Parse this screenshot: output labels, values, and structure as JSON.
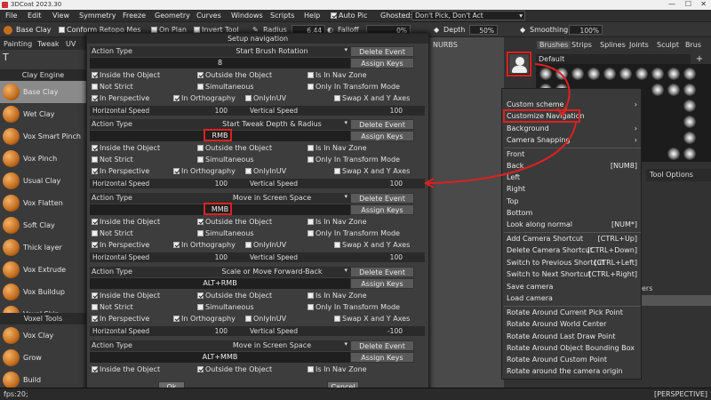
{
  "window": {
    "title": "3DCoat 2023.30"
  },
  "menubar": [
    "File",
    "Edit",
    "View",
    "Symmetry",
    "Freeze",
    "Geometry",
    "Curves",
    "Windows",
    "Scripts",
    "Help"
  ],
  "auto_pic": "Auto Pic",
  "ghosted": {
    "label": "Ghosted:",
    "value": "Don't Pick, Don't Act"
  },
  "toolbar": {
    "base_clay": "Base Clay",
    "conform": "Conform Retopo Mes",
    "on_plan": "On Plan",
    "invert_tool": "Invert Tool",
    "radius_label": "Radius",
    "radius_value": "6.44",
    "falloff_label": "Falloff",
    "falloff_value": "0%",
    "depth_label": "Depth",
    "depth_value": "50%",
    "smoothing_label": "Smoothing",
    "smoothing_value": "100%"
  },
  "left_tabs": [
    "Painting",
    "Tweak",
    "UV"
  ],
  "left_panel": {
    "clay_engine": "Clay Engine",
    "clay_items": [
      "Base Clay",
      "Wet Clay",
      "Vox Smart Pinch",
      "Vox Pinch",
      "Usual Clay",
      "Vox Flatten",
      "Soft Clay",
      "Thick layer",
      "Vox Extrude",
      "Vox Buildup",
      "Voxel Skin"
    ],
    "voxel_tools": "Voxel Tools",
    "voxel_items": [
      "Vox Clay",
      "Grow",
      "Build"
    ]
  },
  "dialog": {
    "title": "Setup navigation",
    "action_type": "Action Type",
    "delete_event": "Delete Event",
    "assign_keys": "Assign Keys",
    "ok": "Ok",
    "cancel": "Cancel",
    "opt": {
      "inside": "Inside the Object",
      "outside": "Outside the Object",
      "nav_zone": "Is In Nav Zone",
      "not_strict": "Not Strict",
      "simultaneous": "Simultaneous",
      "transform_mode": "Only In Transform Mode",
      "perspective": "In Perspective",
      "orthography": "In Orthography",
      "only_uv": "OnlyInUV",
      "swap": "Swap X and Y Axes",
      "hspeed": "Horizontal Speed",
      "vspeed": "Vertical Speed"
    },
    "events": [
      {
        "action": "Start Brush Rotation",
        "keys": "8",
        "hspeed": "100",
        "vspeed": "100",
        "inside": true,
        "outside": true,
        "nav": false,
        "not_strict": false,
        "simult": false,
        "transform": false,
        "persp": true,
        "ortho": true,
        "uv": false,
        "swap": false
      },
      {
        "action": "Start Tweak Depth & Radius",
        "keys": "RMB",
        "hspeed": "100",
        "vspeed": "100",
        "inside": true,
        "outside": false,
        "nav": false,
        "not_strict": false,
        "simult": false,
        "transform": false,
        "persp": true,
        "ortho": true,
        "uv": false,
        "swap": false
      },
      {
        "action": "Move in Screen Space",
        "keys": "MMB",
        "hspeed": "100",
        "vspeed": "100",
        "inside": true,
        "outside": true,
        "nav": false,
        "not_strict": false,
        "simult": false,
        "transform": false,
        "persp": true,
        "ortho": true,
        "uv": false,
        "swap": false
      },
      {
        "action": "Scale or Move Forward-Back",
        "keys": "ALT+RMB",
        "hspeed": "100",
        "vspeed": "-100",
        "inside": true,
        "outside": true,
        "nav": false,
        "not_strict": false,
        "simult": false,
        "transform": false,
        "persp": true,
        "ortho": true,
        "uv": false,
        "swap": false
      },
      {
        "action": "Move in Screen Space",
        "keys": "ALT+MMB",
        "inside": true,
        "outside": true,
        "nav": false
      }
    ]
  },
  "viewport": {
    "nurbs": "NURBS",
    "close": "×"
  },
  "right_panel": {
    "tabs": [
      "Brushes",
      "Strips",
      "Splines",
      "Joints",
      "Sculpt",
      "Brus"
    ],
    "default_label": "Default",
    "tool_options": "Tool Options",
    "side_label": "ers"
  },
  "context_menu": {
    "items": [
      {
        "label": "Custom scheme",
        "sc": "›"
      },
      {
        "label": "Customize Navigation",
        "sc": ""
      },
      {
        "label": "Background",
        "sc": "›"
      },
      {
        "label": "Camera Snapping",
        "sc": "›"
      },
      {
        "label": "Front",
        "sc": ""
      },
      {
        "label": "Back",
        "sc": "[NUM8]"
      },
      {
        "label": "Left",
        "sc": ""
      },
      {
        "label": "Right",
        "sc": ""
      },
      {
        "label": "Top",
        "sc": ""
      },
      {
        "label": "Bottom",
        "sc": ""
      },
      {
        "label": "Look along normal",
        "sc": "[NUM*]"
      },
      {
        "label": "Add Camera Shortcut",
        "sc": "[CTRL+Up]"
      },
      {
        "label": "Delete Camera Shortcut",
        "sc": "[CTRL+Down]"
      },
      {
        "label": "Switch to Previous Shortcut",
        "sc": "[CTRL+Left]"
      },
      {
        "label": "Switch to Next Shortcut",
        "sc": "[CTRL+Right]"
      },
      {
        "label": "Save camera",
        "sc": ""
      },
      {
        "label": "Load camera",
        "sc": ""
      },
      {
        "label": "Rotate Around Current Pick Point",
        "sc": ""
      },
      {
        "label": "Rotate Around World Center",
        "sc": ""
      },
      {
        "label": "Rotate Around Last Draw Point",
        "sc": ""
      },
      {
        "label": "Rotate Around Object Bounding Box",
        "sc": ""
      },
      {
        "label": "Rotate Around Custom Point",
        "sc": ""
      },
      {
        "label": "Rotate around the camera origin",
        "sc": ""
      }
    ]
  },
  "status": {
    "fps": "fps:20;",
    "view": "[PERSPECTIVE]"
  },
  "colors": {
    "highlight": "#e02020",
    "bg": "#3b3b3b",
    "brush_orange": "#c36c1d"
  }
}
